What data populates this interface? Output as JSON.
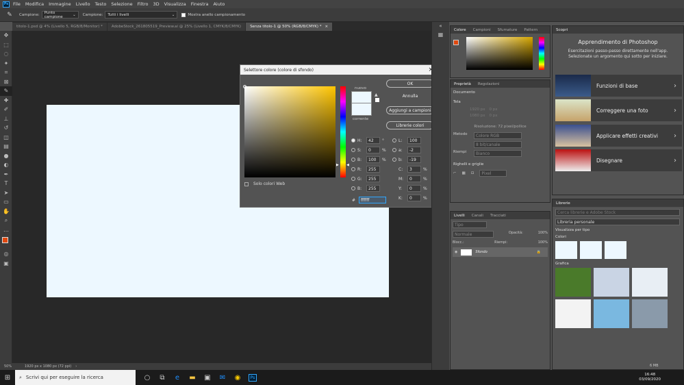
{
  "menu": [
    "File",
    "Modifica",
    "Immagine",
    "Livello",
    "Testo",
    "Selezione",
    "Filtro",
    "3D",
    "Visualizza",
    "Finestra",
    "Aiuto"
  ],
  "options": {
    "campione_label": "Campione:",
    "campione_value": "Punto campione",
    "campione2_label": "Campione:",
    "campione2_value": "Tutti i livelli",
    "ring_label": "Mostra anello campionamento"
  },
  "tabs": [
    "titolo-1.psd @ 4% (Livello 5, RGB/8/Monitor) *",
    "AdobeStock_261805519_Preview.ai @ 25% (Livello 1, CMYK/8/CMYK)",
    "Senza titolo-1 @ 50% (RGB/8/CMYK) *"
  ],
  "status": {
    "zoom": "50%",
    "doc_info": "1920 px x 1080 px (72 ppi)"
  },
  "dialog": {
    "title": "Selettore colore (colore di sfondo)",
    "ok": "OK",
    "cancel": "Annulla",
    "add_swatch": "Aggiungi a campioni",
    "libraries": "Librerie colori",
    "new_label": "nuovo",
    "current_label": "corrente",
    "web_only": "Solo colori Web",
    "fields": {
      "H": "42",
      "S": "0",
      "B": "100",
      "R": "255",
      "G": "255",
      "Bl": "255",
      "L": "100",
      "a": "-2",
      "b": "-19",
      "C": "3",
      "M": "0",
      "Y": "0",
      "K": "0",
      "hex": "ffffff"
    },
    "units": {
      "H": "°",
      "S": "%",
      "B": "%",
      "C": "%",
      "M": "%",
      "Y": "%",
      "K": "%"
    }
  },
  "color_panel": {
    "tabs": [
      "Colore",
      "Campioni",
      "Sfumature",
      "Pattern"
    ]
  },
  "props_panel": {
    "tabs": [
      "Proprietà",
      "Regolazioni"
    ],
    "doc_label": "Documento",
    "canvas": "Tela",
    "w": "1920 px",
    "h": "1080 px",
    "x": "0 px",
    "y": "0 px",
    "resolution": "Risoluzione: 72 pixel/pollice",
    "mode_label": "Metodo",
    "mode": "Colore RGB",
    "bits": "8 bit/canale",
    "fill_label": "Riempi",
    "fill": "Bianco",
    "rulers": "Righelli e griglie",
    "px": "Pixel"
  },
  "layers_panel": {
    "tabs": [
      "Livelli",
      "Canali",
      "Tracciati"
    ],
    "kind": "Tipo",
    "blend": "Normale",
    "opacity_label": "Opacità:",
    "opacity": "100%",
    "lock_label": "Blocc.:",
    "fill_label": "Riempi:",
    "fill": "100%",
    "layer_name": "Sfondo"
  },
  "learn": {
    "tab": "Scopri",
    "title": "Apprendimento di Photoshop",
    "subtitle": "Esercitazioni passo-passo direttamente nell'app. Selezionate un argomento qui sotto per iniziare.",
    "items": [
      "Funzioni di base",
      "Correggere una foto",
      "Applicare effetti creativi",
      "Disegnare"
    ]
  },
  "libraries": {
    "tab": "Librerie",
    "search": "Cerca librerie e Adobe Stock",
    "lib": "Libreria personale",
    "view": "Visualizza per tipo",
    "colors": "Colori",
    "graphics": "Grafica",
    "size": "6 MB"
  },
  "taskbar": {
    "search": "Scrivi qui per eseguire la ricerca",
    "time": "16:48",
    "date": "03/09/2020"
  },
  "colors": {
    "accent": "#31a8ff",
    "fg": "#e0480f",
    "bg": "#edf8ff"
  }
}
